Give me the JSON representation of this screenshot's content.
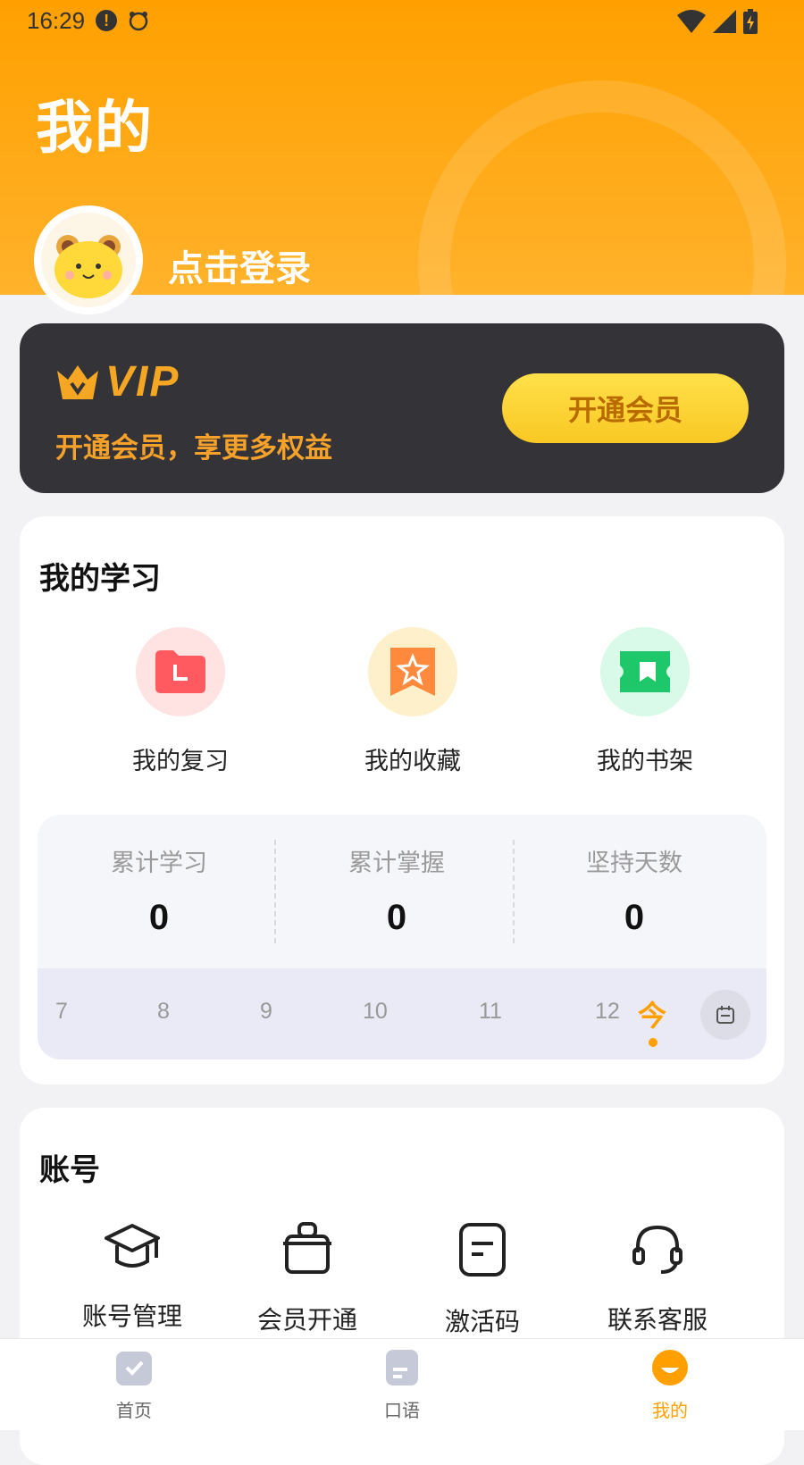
{
  "status_bar": {
    "time": "16:29"
  },
  "header": {
    "title": "我的",
    "login_text": "点击登录"
  },
  "vip": {
    "logo_text": "VIP",
    "subtitle": "开通会员，享更多权益",
    "button_label": "开通会员"
  },
  "study": {
    "title": "我的学习",
    "items": [
      {
        "label": "我的复习",
        "icon": "folder-icon",
        "color": "#ff5a5f",
        "bg": "#ffe3e3"
      },
      {
        "label": "我的收藏",
        "icon": "star-bookmark-icon",
        "color": "#ff8a3d",
        "bg": "#fff0cc"
      },
      {
        "label": "我的书架",
        "icon": "book-ticket-icon",
        "color": "#1ec86a",
        "bg": "#d9fae8"
      }
    ],
    "stats": [
      {
        "label": "累计学习",
        "value": "0"
      },
      {
        "label": "累计掌握",
        "value": "0"
      },
      {
        "label": "坚持天数",
        "value": "0"
      }
    ],
    "calendar_days": [
      "7",
      "8",
      "9",
      "10",
      "11",
      "12"
    ],
    "today_label": "今"
  },
  "account": {
    "title": "账号",
    "items": [
      {
        "label": "账号管理",
        "icon": "graduation-cap-icon"
      },
      {
        "label": "会员开通",
        "icon": "bag-icon"
      },
      {
        "label": "激活码",
        "icon": "document-icon"
      },
      {
        "label": "联系客服",
        "icon": "headset-icon"
      }
    ]
  },
  "tabbar": {
    "items": [
      {
        "label": "首页",
        "active": false
      },
      {
        "label": "口语",
        "active": false
      },
      {
        "label": "我的",
        "active": true
      }
    ]
  },
  "colors": {
    "accent": "#ffa000",
    "vip_card": "#333338",
    "vip_gold": "#f6a12a"
  }
}
